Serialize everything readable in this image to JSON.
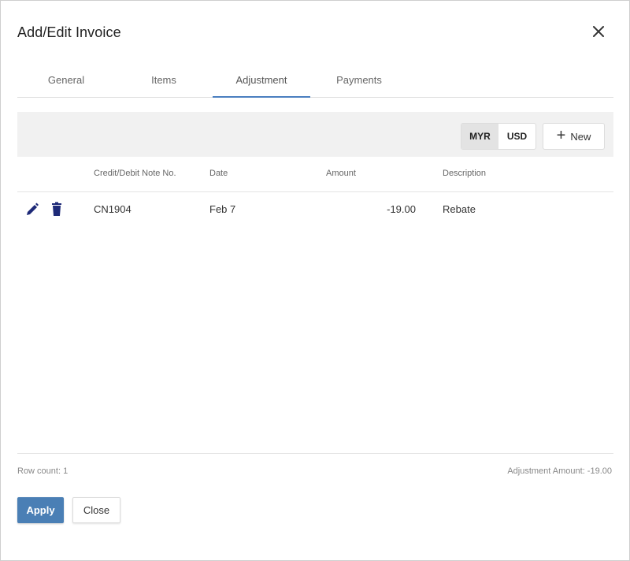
{
  "dialog": {
    "title": "Add/Edit Invoice"
  },
  "tabs": [
    {
      "label": "General",
      "active": false
    },
    {
      "label": "Items",
      "active": false
    },
    {
      "label": "Adjustment",
      "active": true
    },
    {
      "label": "Payments",
      "active": false
    }
  ],
  "toolbar": {
    "currencies": [
      {
        "code": "MYR",
        "selected": true
      },
      {
        "code": "USD",
        "selected": false
      }
    ],
    "new_label": "New",
    "new_icon": "plus-icon"
  },
  "grid": {
    "columns": [
      "Credit/Debit Note No.",
      "Date",
      "Amount",
      "Description"
    ],
    "rows": [
      {
        "note_no": "CN1904",
        "date": "Feb 7",
        "amount": "-19.00",
        "description": "Rebate",
        "actions": [
          "edit-icon",
          "delete-icon"
        ]
      }
    ]
  },
  "footer": {
    "row_count": "Row count: 1",
    "adjustment_amount": "Adjustment Amount: -19.00"
  },
  "buttons": {
    "apply": "Apply",
    "close": "Close"
  },
  "colors": {
    "accent": "#4a7fb5",
    "icon": "#1e2a78",
    "tab_underline": "#4a7fbf"
  }
}
